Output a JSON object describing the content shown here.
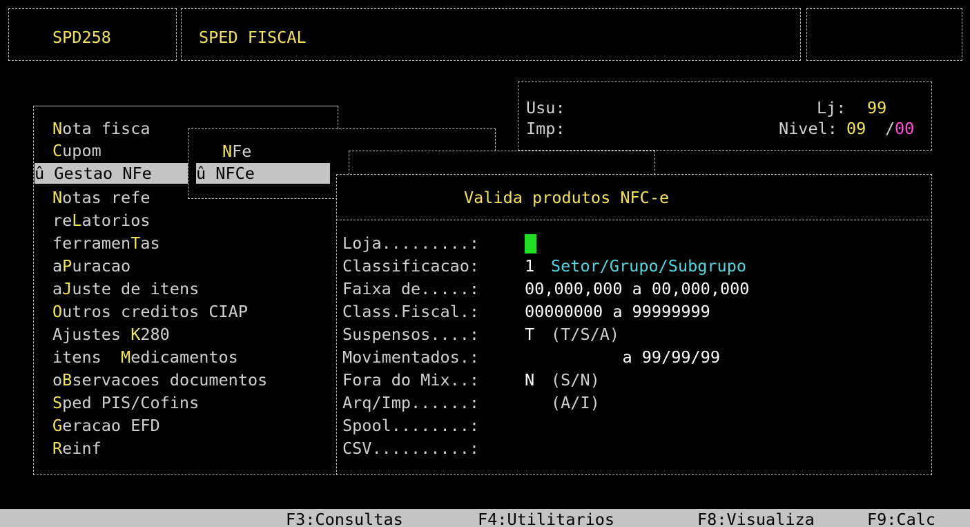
{
  "header": {
    "program_code": "SPD258",
    "program_title": "SPED FISCAL",
    "right_box": ""
  },
  "info_box": {
    "usu_label": "Usu:",
    "imp_label": "Imp:",
    "loja_label": "Lj:",
    "loja_value": "99",
    "nivel_label": "Nivel:",
    "nivel_value_a": "09",
    "nivel_sep": "/",
    "nivel_value_b": "00"
  },
  "main_menu": {
    "items": [
      {
        "hotkey": "N",
        "rest": "ota fisca",
        "prefix": "",
        "selected": false
      },
      {
        "hotkey": "C",
        "rest": "upom",
        "prefix": "",
        "selected": false
      },
      {
        "hotkey": "",
        "rest": "Gestao NFe",
        "prefix": "û ",
        "selected": true
      },
      {
        "hotkey": "N",
        "rest": "otas refe",
        "prefix": "",
        "selected": false
      },
      {
        "pre": "re",
        "hotkey": "L",
        "rest": "atorios",
        "prefix": "",
        "selected": false
      },
      {
        "pre": "ferramen",
        "hotkey": "T",
        "rest": "as",
        "prefix": "",
        "selected": false
      },
      {
        "pre": "a",
        "hotkey": "P",
        "rest": "uracao",
        "prefix": "",
        "selected": false
      },
      {
        "pre": "a",
        "hotkey": "J",
        "rest": "uste de itens",
        "prefix": "",
        "selected": false
      },
      {
        "hotkey": "O",
        "rest": "utros creditos CIAP",
        "prefix": "",
        "selected": false
      },
      {
        "pre": "Ajustes ",
        "hotkey": "K",
        "rest": "280",
        "prefix": "",
        "selected": false
      },
      {
        "pre": "itens  ",
        "hotkey": "M",
        "rest": "edicamentos",
        "prefix": "",
        "selected": false
      },
      {
        "pre": "o",
        "hotkey": "B",
        "rest": "servacoes documentos",
        "prefix": "",
        "selected": false
      },
      {
        "hotkey": "S",
        "rest": "ped PIS/Cofins",
        "prefix": "",
        "selected": false
      },
      {
        "hotkey": "G",
        "rest": "eracao EFD",
        "prefix": "",
        "selected": false
      },
      {
        "hotkey": "R",
        "rest": "einf",
        "prefix": "",
        "selected": false
      }
    ]
  },
  "sub_menu": {
    "item1_hotkey": "N",
    "item1_rest": "Fe",
    "item2_label": "û NFCe"
  },
  "dialog": {
    "title": "Valida produtos NFC-e",
    "fields": [
      {
        "label": "Loja.........:",
        "value": ""
      },
      {
        "label": "Classificacao:",
        "value": "1",
        "extra": "Setor/Grupo/Subgrupo"
      },
      {
        "label": "Faixa de.....:",
        "value": "00,000,000 a 00,000,000"
      },
      {
        "label": "Class.Fiscal.:",
        "value": "00000000 a 99999999"
      },
      {
        "label": "Suspensos....:",
        "value": "T",
        "extra": "(T/S/A)"
      },
      {
        "label": "Movimentados.:",
        "value": "          a 99/99/99"
      },
      {
        "label": "Fora do Mix..:",
        "value": "N",
        "extra": "(S/N)"
      },
      {
        "label": "Arq/Imp......:",
        "value": "",
        "extra": "(A/I)"
      },
      {
        "label": "Spool........:",
        "value": ""
      },
      {
        "label": "CSV..........:",
        "value": ""
      }
    ]
  },
  "status_bar": {
    "f3": "F3:Consultas",
    "f4": "F4:Utilitarios",
    "f8": "F8:Visualiza",
    "f9": "F9:Calc"
  },
  "colors": {
    "background": "#000000",
    "highlight_yellow": "#f2e35b",
    "cyan": "#4fd8e0",
    "magenta": "#ff4fd8",
    "cursor_green": "#22dd22",
    "status_bar": "#c4c4c4"
  }
}
